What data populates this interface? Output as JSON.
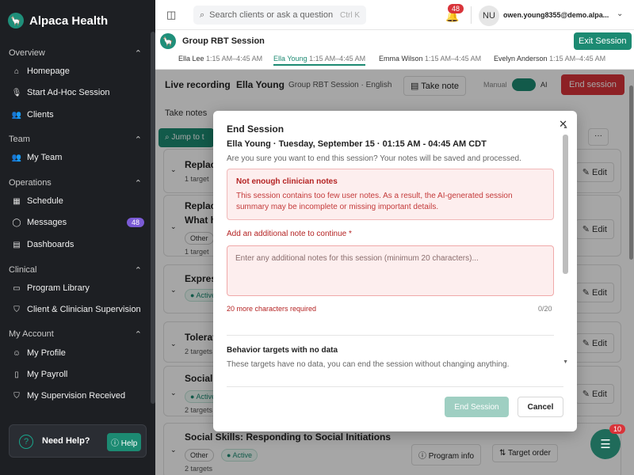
{
  "brand": {
    "name": "Alpaca Health"
  },
  "sidebar": {
    "overview": {
      "label": "Overview",
      "items": [
        "Homepage",
        "Start Ad-Hoc Session",
        "Clients"
      ]
    },
    "team": {
      "label": "Team",
      "items": [
        "My Team"
      ]
    },
    "operations": {
      "label": "Operations",
      "items": [
        "Schedule",
        "Messages",
        "Dashboards"
      ],
      "messages_badge": "48"
    },
    "clinical": {
      "label": "Clinical",
      "items": [
        "Program Library",
        "Client & Clinician Supervision"
      ]
    },
    "account": {
      "label": "My Account",
      "items": [
        "My Profile",
        "My Payroll",
        "My Supervision Received"
      ]
    },
    "help": {
      "title": "Need Help?",
      "button": "Help"
    }
  },
  "topbar": {
    "search_placeholder": "Search clients or ask a question",
    "search_shortcut": "Ctrl K",
    "notif_count": "48",
    "avatar_initials": "NU",
    "user_email": "owen.young8355@demo.alpa..."
  },
  "session": {
    "title": "Group RBT Session",
    "exit_label": "Exit Session",
    "tabs": [
      {
        "name": "Ella Lee",
        "time": "1:15 AM–4:45 AM"
      },
      {
        "name": "Ella Young",
        "time": "1:15 AM–4:45 AM"
      },
      {
        "name": "Emma Wilson",
        "time": "1:15 AM–4:45 AM"
      },
      {
        "name": "Evelyn Anderson",
        "time": "1:15 AM–4:45 AM"
      }
    ]
  },
  "recording": {
    "label": "Live recording",
    "client": "Ella Young",
    "meta": "Group RBT Session · English",
    "take_note": "Take note",
    "manual": "Manual",
    "ai": "AI",
    "end_session": "End session"
  },
  "background": {
    "take_notes": "Take notes",
    "jump": "Jump to t",
    "more": "···",
    "edit": "Edit",
    "program_info": "Program info",
    "target_order": "Target order",
    "cards": [
      {
        "title": "Replac",
        "sub": "1 target"
      },
      {
        "title": "Replac",
        "line2": "What h",
        "tag": "Other",
        "sub": "1 target"
      },
      {
        "title": "Expres",
        "tag": "Active"
      },
      {
        "title": "Tolerat",
        "sub": "2 targets"
      },
      {
        "title": "Social",
        "tag": "Active",
        "sub": "2 targets"
      },
      {
        "title": "Social Skills: Responding to Social Initiations",
        "tag1": "Other",
        "tag2": "Active",
        "sub": "2 targets"
      }
    ]
  },
  "modal": {
    "title": "End Session",
    "subtitle": "Ella Young · Tuesday, September 15 · 01:15 AM - 04:45 AM CDT",
    "confirm": "Are you sure you want to end this session? Your notes will be saved and processed.",
    "warn_title": "Not enough clinician notes",
    "warn_body": "This session contains too few user notes. As a result, the AI-generated session summary may be incomplete or missing important details.",
    "note_label": "Add an additional note to continue",
    "note_required": "*",
    "note_placeholder": "Enter any additional notes for this session (minimum 20 characters)...",
    "chars_required": "20 more characters required",
    "char_count": "0/20",
    "behavior_title": "Behavior targets with no data",
    "behavior_body": "These targets have no data, you can end the session without changing anything.",
    "end_button": "End Session",
    "cancel_button": "Cancel"
  },
  "fab": {
    "count": "10"
  }
}
